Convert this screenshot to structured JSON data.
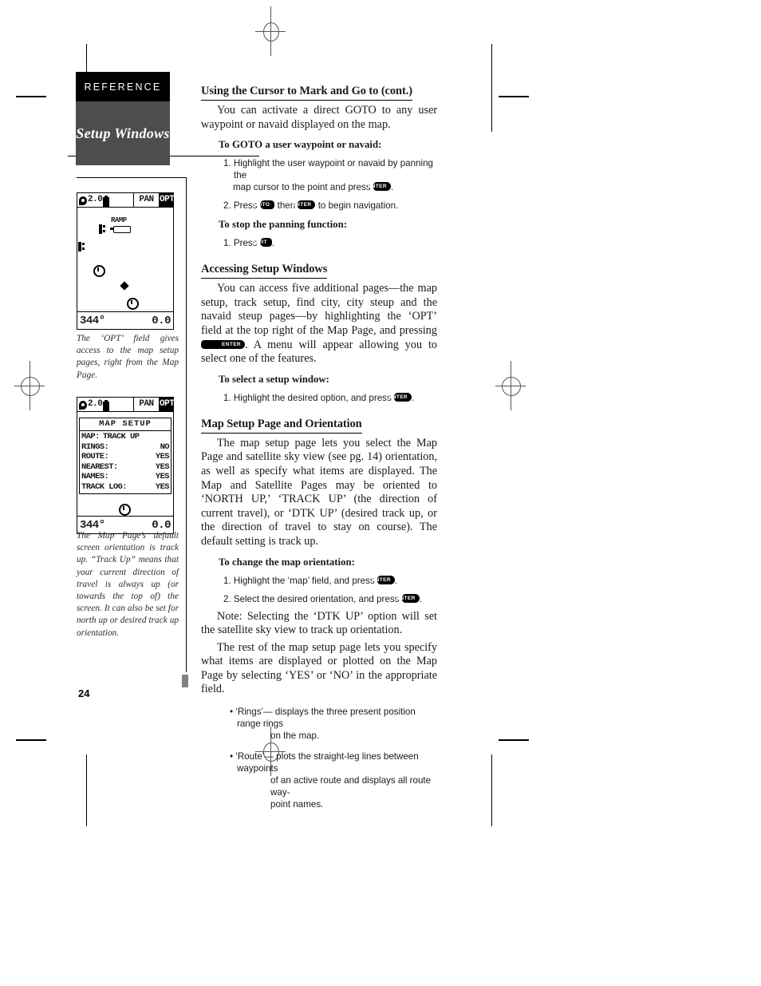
{
  "sidebar": {
    "reference_label": "REFERENCE",
    "tab_label": "Setup Windows",
    "page_number": "24",
    "caption_one": "The ‘OPT’ field gives access to the map setup pages, right from the Map Page.",
    "caption_two": "The Map Page’s default screen orientation is track up. “Track Up” means that your current direction of travel is always up (or towards the top of) the screen. It can also be set for north up or desired track up orientation."
  },
  "gps_screen_one": {
    "zoom_value": "2.0",
    "pan_label": "PAN",
    "opt_label": "OPT",
    "map_label_ramp": "RAMP",
    "heading": "344°",
    "speed": "0.0"
  },
  "gps_screen_two": {
    "zoom_value": "2.0",
    "pan_label": "PAN",
    "opt_label": "OPT",
    "window_title": "MAP SETUP",
    "rows": [
      {
        "key": "MAP:",
        "value": "TRACK UP"
      },
      {
        "key": "RINGS:",
        "value": "NO"
      },
      {
        "key": "ROUTE:",
        "value": "YES"
      },
      {
        "key": "NEAREST:",
        "value": "YES"
      },
      {
        "key": "NAMES:",
        "value": "YES"
      },
      {
        "key": "TRACK LOG:",
        "value": "YES"
      }
    ],
    "heading": "344°",
    "speed": "0.0"
  },
  "main": {
    "section_one": {
      "heading": "Using the Cursor to Mark and Go to (cont.)",
      "paragraph": "You can activate a direct GOTO to any user waypoint or navaid displayed on the map.",
      "subhead_one": "To GOTO a user waypoint or navaid:",
      "step_one_a": "1. Highlight the user waypoint or navaid by panning the",
      "step_one_b": "map cursor to the point and press",
      "step_one_key": "ENTER",
      "step_one_end": ".",
      "step_two_a": "2. Press",
      "step_two_key_goto": "GOTO",
      "step_two_b": "then",
      "step_two_key_enter": "ENTER",
      "step_two_c": "to begin navigation.",
      "subhead_two": "To stop the panning function:",
      "step_three_a": "1. Press",
      "step_three_key": "QUIT",
      "step_three_end": "."
    },
    "section_two": {
      "heading": "Accessing Setup Windows",
      "paragraph_a": "You can access five additional pages—the map setup, track setup, find city, city steup and the navaid steup pages—by highlighting the ‘OPT’ field at the top right of the Map Page, and pressing",
      "paragraph_key": "ENTER",
      "paragraph_b": ".  A menu will appear allowing you to select one of the features.",
      "subhead": "To select a setup window:",
      "step_a": "1. Highlight the desired option, and press",
      "step_key": "ENTER",
      "step_end": "."
    },
    "section_three": {
      "heading": "Map Setup Page and Orientation",
      "paragraph": "The map setup page lets you select the Map Page and satellite sky view (see pg. 14) orientation, as well as specify what items are displayed.  The Map and Satellite Pages may be oriented to ‘NORTH UP,’ ‘TRACK UP’ (the direction of current travel), or ‘DTK UP’ (desired track up, or the direction of travel to stay on course).  The default setting is track up.",
      "subhead": "To change the map orientation:",
      "step_one_a": "1. Highlight the ‘map’ field, and press",
      "step_one_key": "ENTER",
      "step_one_end": ".",
      "step_two_a": "2. Select the desired orientation, and press",
      "step_two_key": "ENTER",
      "step_two_end": ".",
      "note": "Note: Selecting the ‘DTK UP’ option will set the satellite sky view to track up orientation.",
      "paragraph_two": "The rest of the map setup page lets you specify what items are displayed or plotted on the Map Page by selecting ‘YES’ or ‘NO’ in the appropriate field.",
      "bullet_one_a": "• ‘Rings’— displays the three present position range rings",
      "bullet_one_b": "on the map.",
      "bullet_two_a": "• ‘Route’— plots the straight-leg lines between waypoints",
      "bullet_two_b": "of an active route and displays all route way-",
      "bullet_two_c": "point names."
    }
  },
  "colors": {
    "reference_bg": "#000000",
    "tab_bg": "#4d4d4d",
    "paper": "#ffffff",
    "ink": "#1a1a1a",
    "end_mark": "#808080"
  }
}
